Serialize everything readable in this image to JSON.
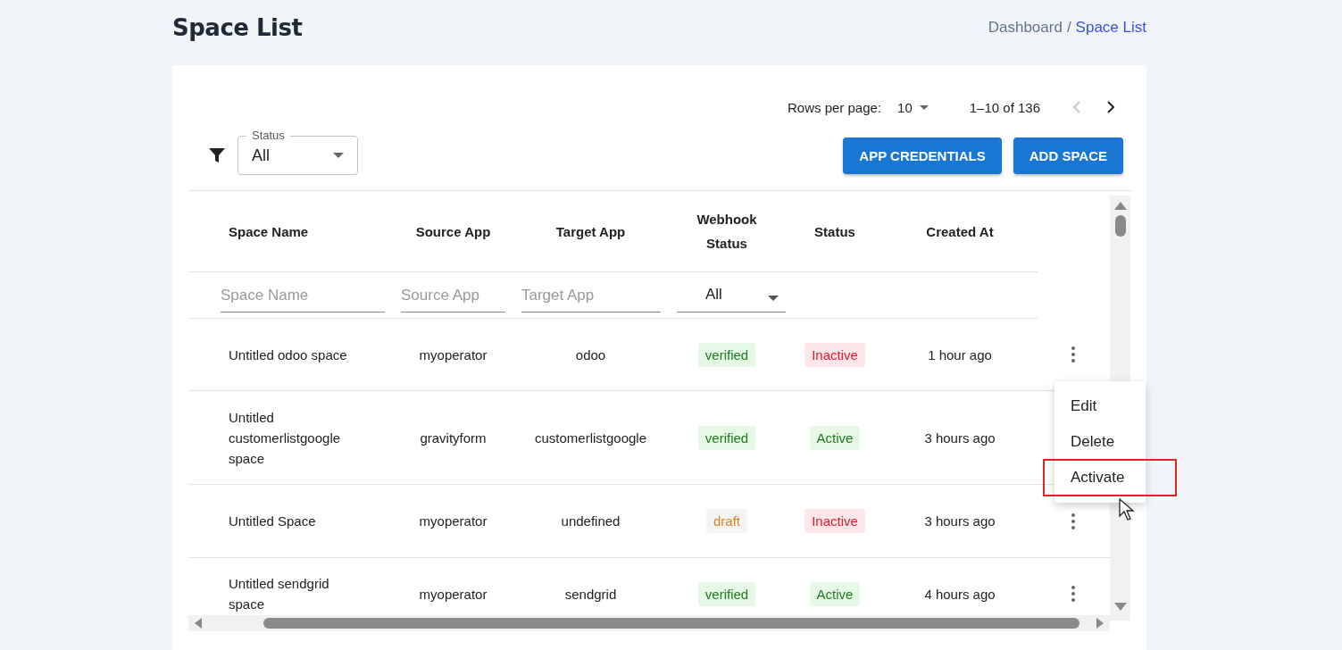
{
  "page_title": "Space List",
  "breadcrumb": {
    "separator": "/",
    "items": [
      {
        "label": "Dashboard",
        "selected": false
      },
      {
        "label": "Space List",
        "selected": true
      }
    ]
  },
  "pagination": {
    "label": "Rows per page:",
    "rows_per_page": "10",
    "range": "1–10 of 136",
    "prev_disabled": true,
    "next_disabled": false
  },
  "status_filter": {
    "label": "Status",
    "value": "All"
  },
  "buttons": [
    "APP CREDENTIALS",
    "ADD SPACE"
  ],
  "table": {
    "columns": [
      "Space Name",
      "Source App",
      "Target App",
      "Webhook Status",
      "Status",
      "Created At"
    ],
    "filters": [
      {
        "kind": "text",
        "placeholder": "Space Name"
      },
      {
        "kind": "text",
        "placeholder": "Source App"
      },
      {
        "kind": "text",
        "placeholder": "Target App"
      },
      {
        "kind": "select",
        "value": "All"
      }
    ],
    "rows": [
      {
        "space_name": "Untitled odoo space",
        "source_app": "myoperator",
        "target_app": "odoo",
        "webhook_status": "verified",
        "webhook_verified": true,
        "status": "Inactive",
        "active": false,
        "created_at": "1 hour ago"
      },
      {
        "space_name": "Untitled customerlistgoogle space",
        "source_app": "gravityform",
        "target_app": "customerlistgoogle",
        "webhook_status": "verified",
        "webhook_verified": true,
        "status": "Active",
        "active": true,
        "created_at": "3 hours ago"
      },
      {
        "space_name": "Untitled Space",
        "source_app": "myoperator",
        "target_app": "undefined",
        "webhook_status": "draft",
        "webhook_verified": false,
        "status": "Inactive",
        "active": false,
        "created_at": "3 hours ago"
      },
      {
        "space_name": "Untitled sendgrid space",
        "source_app": "myoperator",
        "target_app": "sendgrid",
        "webhook_status": "verified",
        "webhook_verified": true,
        "status": "Active",
        "active": true,
        "created_at": "4 hours ago"
      }
    ]
  },
  "row_menu": {
    "items": [
      {
        "label": "Edit",
        "highlighted": false
      },
      {
        "label": "Delete",
        "highlighted": false
      },
      {
        "label": "Activate",
        "highlighted": true
      }
    ]
  }
}
